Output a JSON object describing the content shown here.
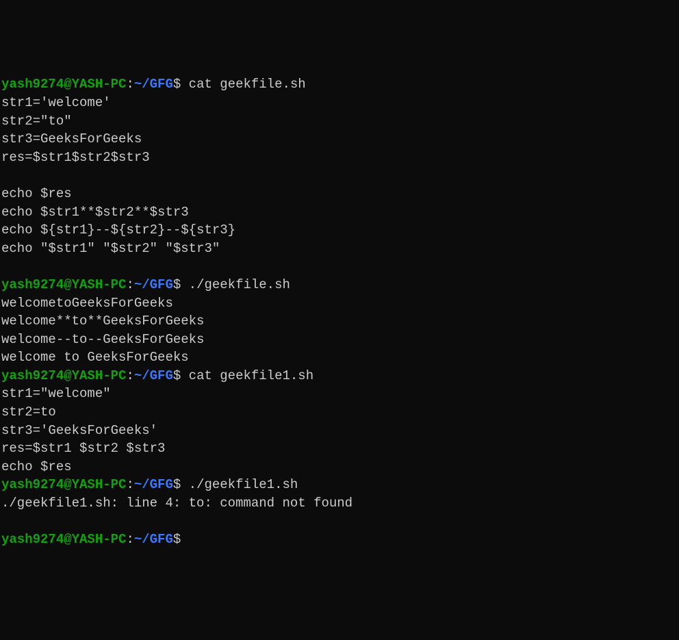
{
  "prompt": {
    "user_host": "yash9274@YASH-PC",
    "colon": ":",
    "path": "~/GFG",
    "dollar": "$"
  },
  "lines": {
    "cmd1": " cat geekfile.sh",
    "out1": "str1='welcome'",
    "out2": "str2=\"to\"",
    "out3": "str3=GeeksForGeeks",
    "out4": "res=$str1$str2$str3",
    "blank1": "",
    "out5": "echo $res",
    "out6": "echo $str1**$str2**$str3",
    "out7": "echo ${str1}--${str2}--${str3}",
    "out8": "echo \"$str1\" \"$str2\" \"$str3\"",
    "blank2": "",
    "cmd2": " ./geekfile.sh",
    "out9": "welcometoGeeksForGeeks",
    "out10": "welcome**to**GeeksForGeeks",
    "out11": "welcome--to--GeeksForGeeks",
    "out12": "welcome to GeeksForGeeks",
    "cmd3": " cat geekfile1.sh",
    "out13": "str1=\"welcome\"",
    "out14": "str2=to",
    "out15": "str3='GeeksForGeeks'",
    "out16": "res=$str1 $str2 $str3",
    "out17": "echo $res",
    "cmd4": " ./geekfile1.sh",
    "out18": "./geekfile1.sh: line 4: to: command not found",
    "blank3": "",
    "cmd5": ""
  }
}
